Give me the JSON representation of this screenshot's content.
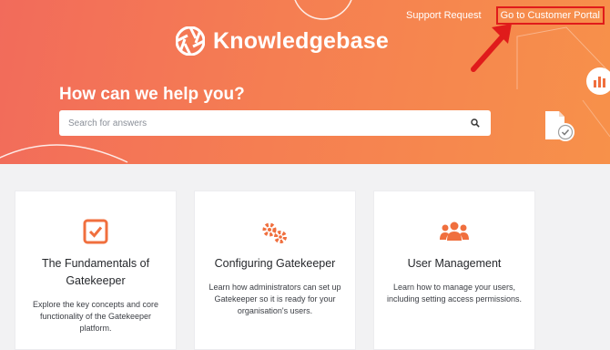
{
  "colors": {
    "accent": "#f06f3e",
    "hero_start": "#f26b5b",
    "hero_end": "#f7914a",
    "highlight": "#e01b1b"
  },
  "nav": {
    "support_request": "Support Request",
    "customer_portal": "Go to Customer Portal"
  },
  "brand": {
    "name": "Knowledgebase",
    "logo_icon": "aperture-logo-icon"
  },
  "hero": {
    "title": "How can we help you?"
  },
  "search": {
    "placeholder": "Search for answers",
    "value": "",
    "icon": "search-icon"
  },
  "cards": [
    {
      "icon": "checkbox-icon",
      "title": "The Fundamentals of Gatekeeper",
      "description": "Explore the key concepts and core functionality of the Gatekeeper platform."
    },
    {
      "icon": "gears-icon",
      "title": "Configuring Gatekeeper",
      "description": "Learn how administrators can set up Gatekeeper so it is ready for your organisation's users."
    },
    {
      "icon": "users-icon",
      "title": "User Management",
      "description": "Learn how to manage your users, including setting access permissions."
    }
  ]
}
